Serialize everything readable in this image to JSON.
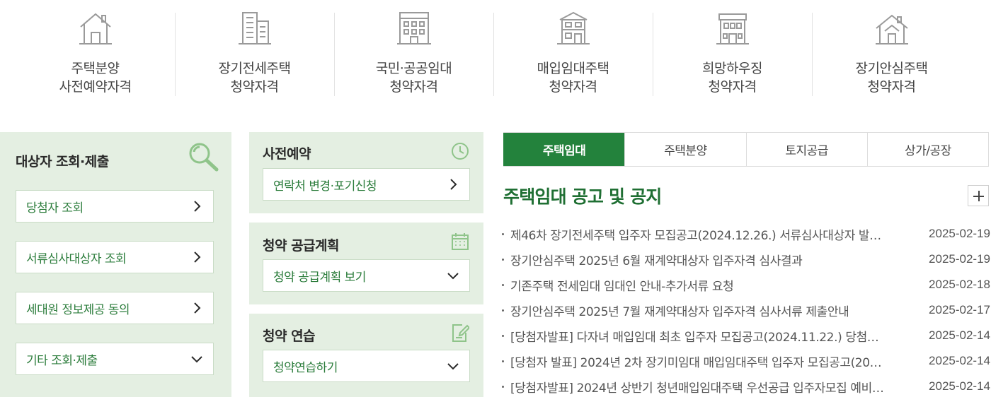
{
  "categories": [
    {
      "line1": "주택분양",
      "line2": "사전예약자격",
      "icon": "house-icon"
    },
    {
      "line1": "장기전세주택",
      "line2": "청약자격",
      "icon": "apartment-icon"
    },
    {
      "line1": "국민·공공임대",
      "line2": "청약자격",
      "icon": "building-icon"
    },
    {
      "line1": "매입임대주택",
      "line2": "청약자격",
      "icon": "townhouse-icon"
    },
    {
      "line1": "희망하우징",
      "line2": "청약자격",
      "icon": "dormitory-icon"
    },
    {
      "line1": "장기안심주택",
      "line2": "청약자격",
      "icon": "home-icon"
    }
  ],
  "left_panel": {
    "title": "대상자 조회·제출",
    "buttons": [
      {
        "label": "당첨자 조회",
        "arrow": "chevron-right"
      },
      {
        "label": "서류심사대상자 조회",
        "arrow": "chevron-right"
      },
      {
        "label": "세대원 정보제공 동의",
        "arrow": "chevron-right"
      },
      {
        "label": "기타 조회·제출",
        "arrow": "chevron-down"
      }
    ]
  },
  "middle_panels": [
    {
      "title": "사전예약",
      "icon": "clock-icon",
      "button": "연락처 변경·포기신청",
      "arrow": "chevron-right"
    },
    {
      "title": "청약 공급계획",
      "icon": "calendar-icon",
      "button": "청약 공급계획 보기",
      "arrow": "chevron-down"
    },
    {
      "title": "청약 연습",
      "icon": "edit-icon",
      "button": "청약연습하기",
      "arrow": "chevron-down"
    }
  ],
  "tabs": [
    "주택임대",
    "주택분양",
    "토지공급",
    "상가/공장"
  ],
  "active_tab": 0,
  "notices": {
    "title": "주택임대 공고 및 공지",
    "items": [
      {
        "text": "제46차 장기전세주택 입주자 모집공고(2024.12.26.) 서류심사대상자 발…",
        "date": "2025-02-19"
      },
      {
        "text": "장기안심주택 2025년 6월 재계약대상자 입주자격 심사결과",
        "date": "2025-02-19"
      },
      {
        "text": "기존주택 전세임대 임대인 안내-추가서류 요청",
        "date": "2025-02-18"
      },
      {
        "text": "장기안심주택 2025년 7월 재계약대상자 입주자격 심사서류 제출안내",
        "date": "2025-02-17"
      },
      {
        "text": "[당첨자발표] 다자녀 매입임대 최초 입주자 모집공고(2024.11.22.) 당첨…",
        "date": "2025-02-14"
      },
      {
        "text": "[당첨자 발표] 2024년 2차 장기미임대 매입임대주택 입주자 모집공고(20…",
        "date": "2025-02-14"
      },
      {
        "text": "[당첨자발표] 2024년 상반기 청년매입임대주택 우선공급 입주자모집 예비…",
        "date": "2025-02-14"
      }
    ]
  },
  "colors": {
    "accent": "#23823c",
    "panel_bg": "#e4efe2",
    "link_text": "#2c7d3c"
  }
}
